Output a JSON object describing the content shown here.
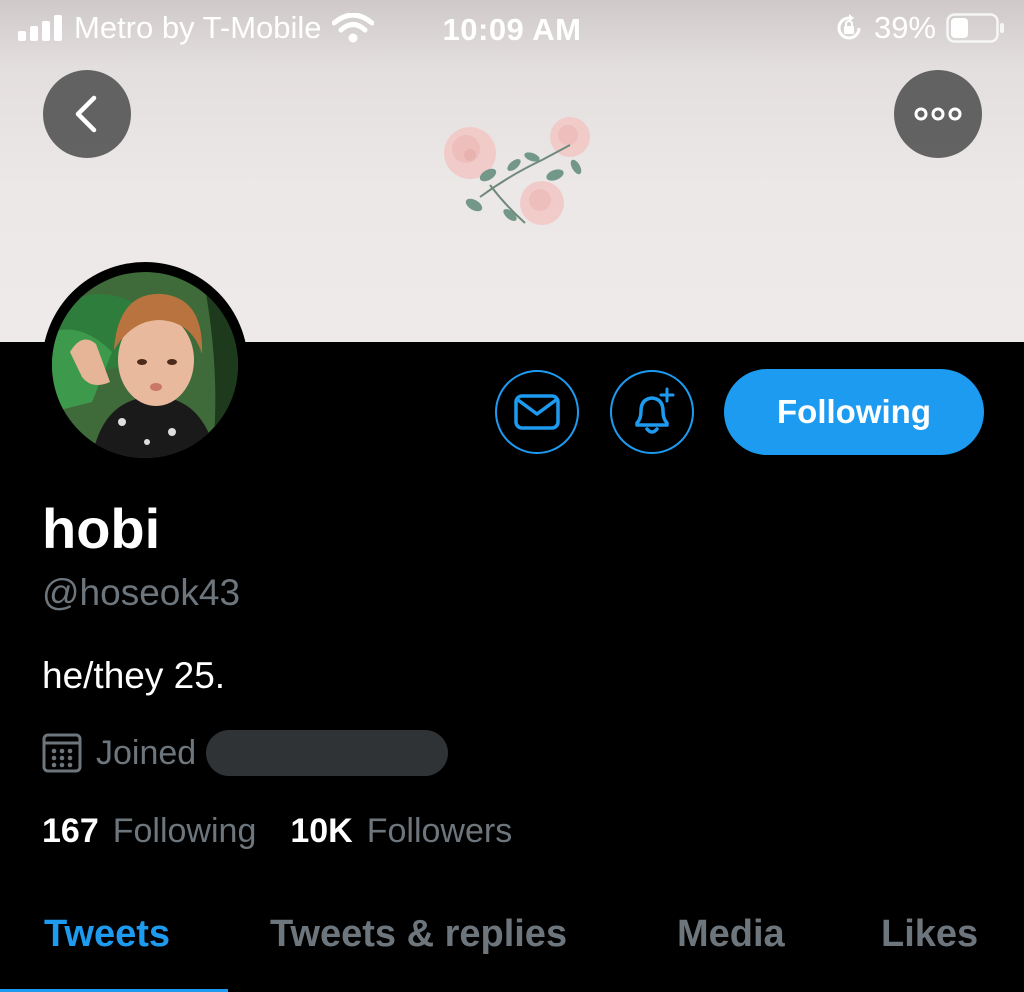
{
  "status_bar": {
    "carrier": "Metro by T-Mobile",
    "time": "10:09 AM",
    "battery_percent": "39%",
    "battery_level": 0.39,
    "icons": [
      "signal-bars-icon",
      "wifi-icon",
      "orientation-lock-icon",
      "battery-icon"
    ]
  },
  "header": {
    "back_icon": "chevron-left-icon",
    "more_icon": "more-horizontal-icon"
  },
  "profile": {
    "display_name": "hobi",
    "handle": "@hoseok43",
    "bio": "he/they 25.",
    "joined_label": "Joined",
    "following_count": "167",
    "following_label": "Following",
    "followers_count": "10K",
    "followers_label": "Followers"
  },
  "actions": {
    "message_icon": "envelope-icon",
    "notify_icon": "bell-plus-icon",
    "follow_label": "Following"
  },
  "tabs": [
    {
      "label": "Tweets",
      "active": true
    },
    {
      "label": "Tweets & replies",
      "active": false
    },
    {
      "label": "Media",
      "active": false
    },
    {
      "label": "Likes",
      "active": false
    }
  ],
  "colors": {
    "accent": "#1d9bf0",
    "background": "#000000",
    "secondary_text": "#6e767d"
  }
}
